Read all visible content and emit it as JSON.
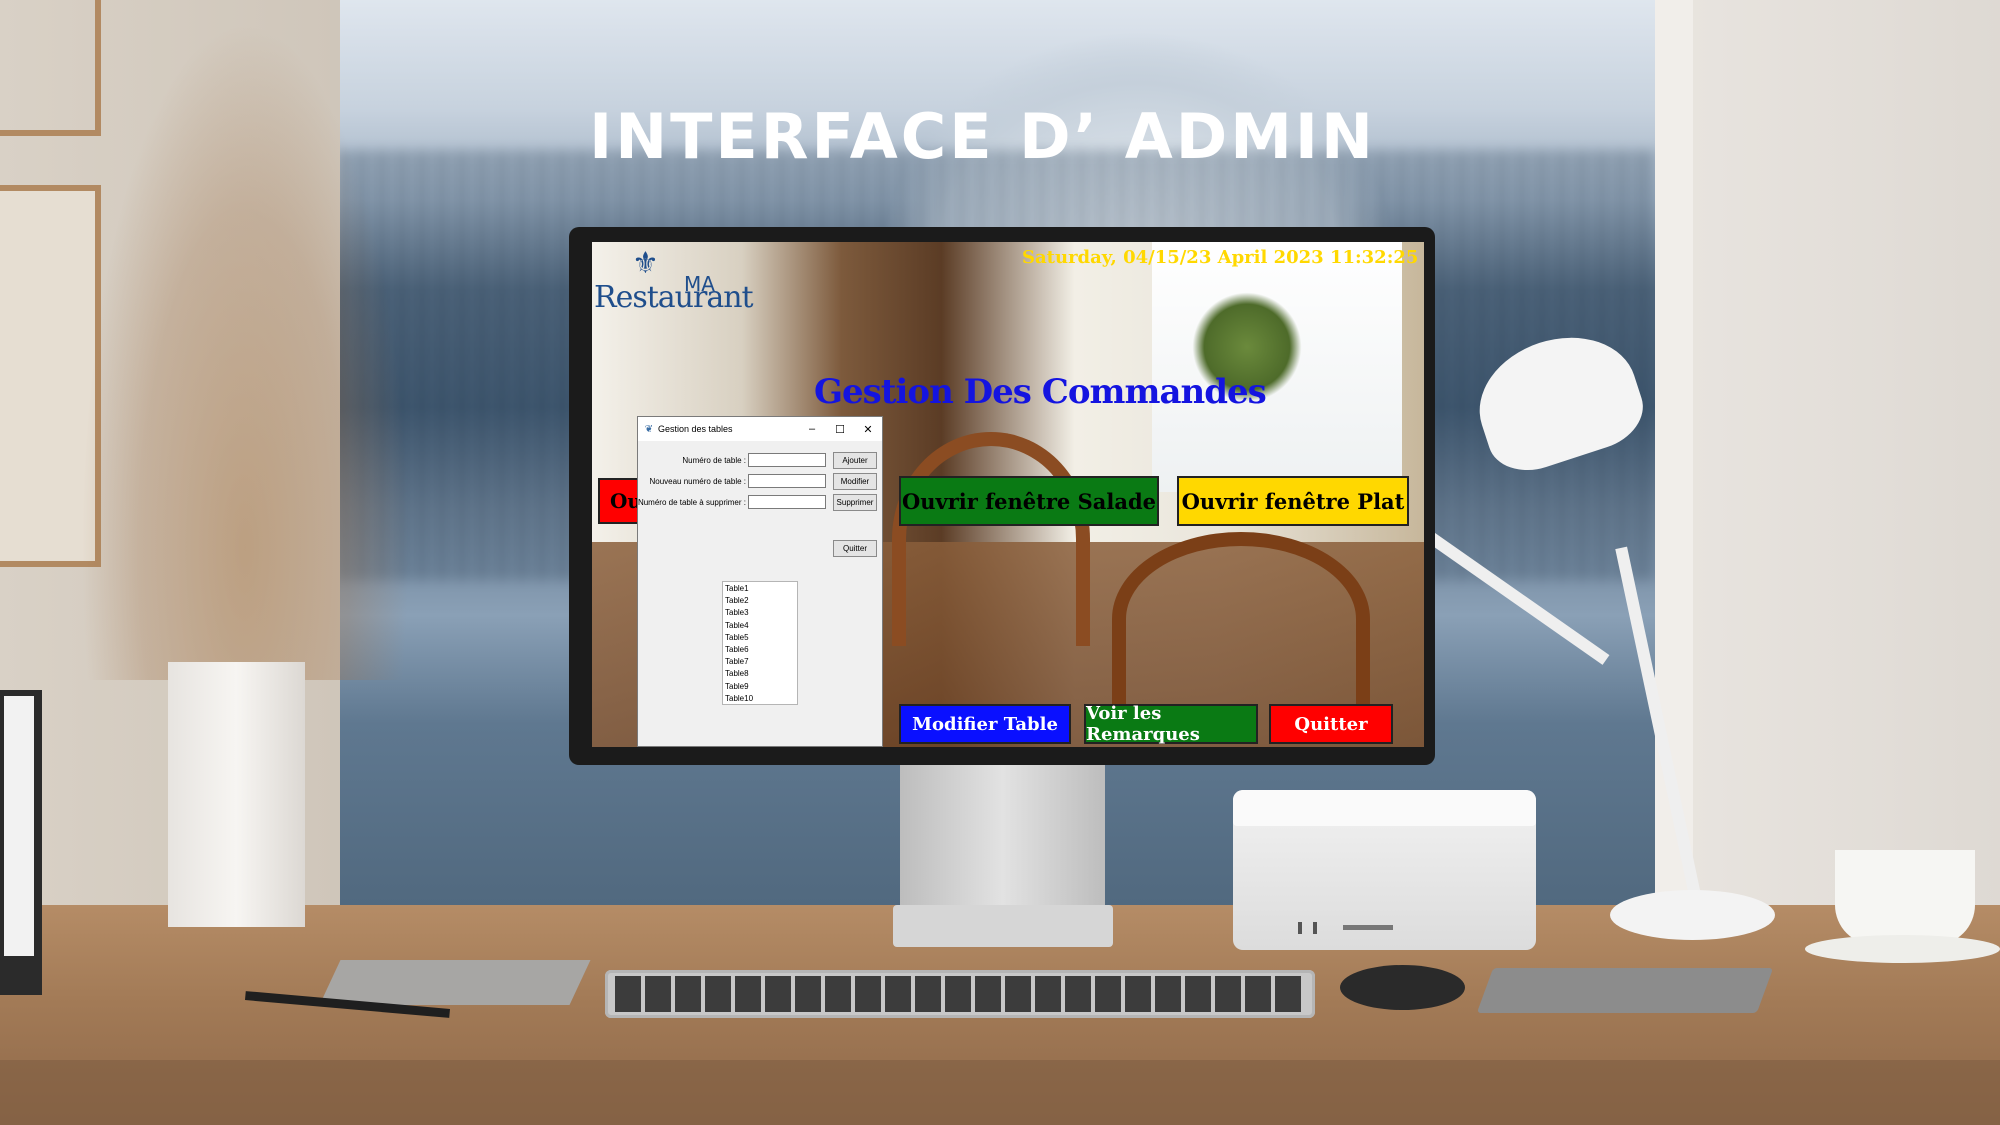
{
  "headline": "INTERFACE D’ ADMIN",
  "app": {
    "logo": {
      "top": "MA",
      "bottom": "Restaurant"
    },
    "datetime": "Saturday, 04/15/23 April 2023 11:32:25",
    "title": "Gestion Des Commandes",
    "buttons": {
      "left_partial": "Ou",
      "salade": "Ouvrir fenêtre Salade",
      "plat": "Ouvrir fenêtre Plat",
      "modifier_table": "Modifier Table",
      "voir_remarques": "Voir les Remarques",
      "quitter": "Quitter"
    }
  },
  "tables_window": {
    "title": "Gestion des tables",
    "controls": {
      "minimize": "–",
      "maximize": "☐",
      "close": "✕"
    },
    "rows": [
      {
        "label": "Numéro de table :",
        "button": "Ajouter"
      },
      {
        "label": "Nouveau numéro de table :",
        "button": "Modifier"
      },
      {
        "label": "Numéro de table à supprimer :",
        "button": "Supprimer"
      }
    ],
    "quit_button": "Quitter",
    "tables": [
      "Table1",
      "Table2",
      "Table3",
      "Table4",
      "Table5",
      "Table6",
      "Table7",
      "Table8",
      "Table9",
      "Table10"
    ]
  },
  "colors": {
    "title_blue": "#1414e0",
    "datetime_yellow": "#ffd800",
    "green": "#0a7a14",
    "red": "#ff0000",
    "blue_button": "#0a10ff"
  }
}
